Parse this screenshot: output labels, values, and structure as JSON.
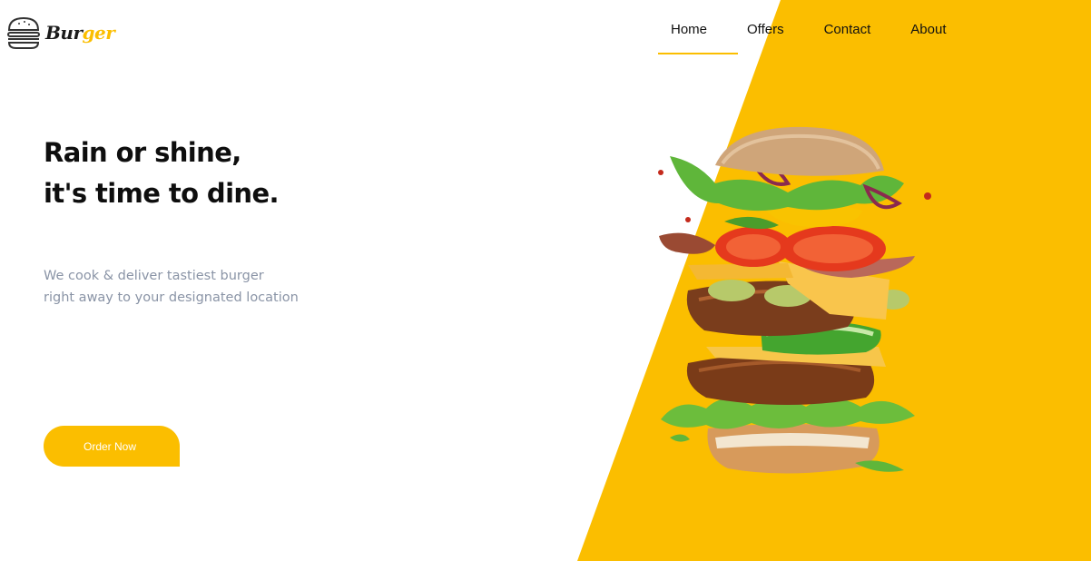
{
  "brand": {
    "name_part1": "Bur",
    "name_part2": "ger",
    "accent": "#fbbe00"
  },
  "nav": {
    "items": [
      {
        "label": "Home"
      },
      {
        "label": "Offers"
      },
      {
        "label": "Contact"
      },
      {
        "label": "About"
      }
    ]
  },
  "hero": {
    "headline_line1": "Rain or shine,",
    "headline_line2": "it's time to dine.",
    "subtext_line1": "We cook & deliver tastiest burger",
    "subtext_line2": "right away to your designated location",
    "cta_label": "Order Now"
  },
  "icons": {
    "logo": "burger-icon",
    "hero_image": "burger-image"
  }
}
